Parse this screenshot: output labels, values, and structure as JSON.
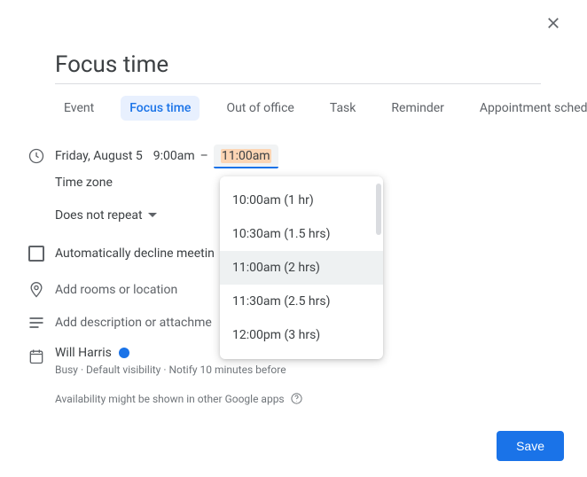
{
  "title": "Focus time",
  "tabs": {
    "event": "Event",
    "focus": "Focus time",
    "ooo": "Out of office",
    "task": "Task",
    "reminder": "Reminder",
    "appointment": "Appointment schedule"
  },
  "time": {
    "date": "Friday, August 5",
    "start": "9:00am",
    "sep": "–",
    "end": "11:00am"
  },
  "timezone_label": "Time zone",
  "repeat_label": "Does not repeat",
  "decline_label": "Automatically decline meetin",
  "location_placeholder": "Add rooms or location",
  "description_placeholder": "Add description or attachme",
  "user": {
    "name": "Will Harris",
    "sub": "Busy · Default visibility · Notify 10 minutes before"
  },
  "availability_note": "Availability might be shown in other Google apps",
  "save_label": "Save",
  "end_options": [
    {
      "label": "10:00am (1 hr)"
    },
    {
      "label": "10:30am (1.5 hrs)"
    },
    {
      "label": "11:00am (2 hrs)"
    },
    {
      "label": "11:30am (2.5 hrs)"
    },
    {
      "label": "12:00pm (3 hrs)"
    }
  ]
}
